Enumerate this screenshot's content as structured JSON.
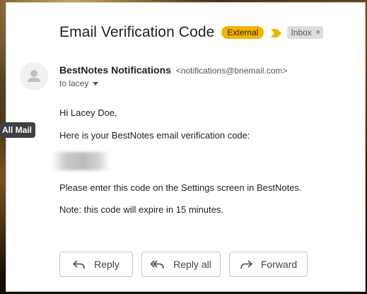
{
  "email": {
    "subject": "Email Verification Code",
    "labels": {
      "external": "External",
      "inbox": "Inbox",
      "inbox_remove": "×"
    },
    "sender": {
      "name": "BestNotes Notifications",
      "email": "<notifications@bnemail.com>",
      "to": "to lacey"
    },
    "body": {
      "greeting": "Hi Lacey Doe,",
      "intro": "Here is your BestNotes email verification code:",
      "instruction": "Please enter this code on the Settings screen in BestNotes.",
      "note": "Note: this code will expire in 15 minutes."
    }
  },
  "actions": {
    "reply": "Reply",
    "reply_all": "Reply all",
    "forward": "Forward"
  },
  "tooltip": "All Mail",
  "colors": {
    "external_badge": "#f4b400",
    "important_marker": "#f4b400",
    "inbox_badge": "#dddddd"
  },
  "icons": {
    "important": "important-marker-icon",
    "avatar": "person-icon",
    "recipients": "chevron-down-icon",
    "reply": "reply-arrow-icon",
    "reply_all": "reply-all-arrow-icon",
    "forward": "forward-arrow-icon"
  }
}
